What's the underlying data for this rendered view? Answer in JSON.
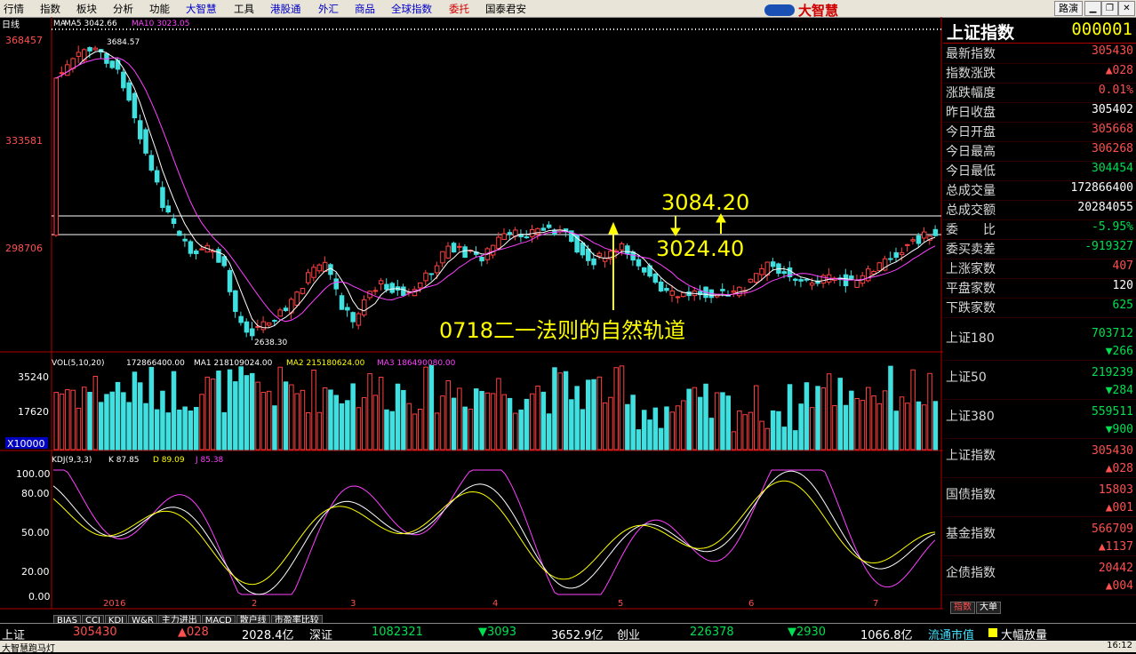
{
  "menu": [
    "行情",
    "指数",
    "板块",
    "分析",
    "功能",
    "大智慧",
    "工具",
    "港股通",
    "外汇",
    "商品",
    "全球指数",
    "委托",
    "国泰君安"
  ],
  "brand": "大智慧",
  "route_label": "路演",
  "chart": {
    "period_label": "日线",
    "ma_header": {
      "ma": "MA",
      "ma5": "MA5 3042.66",
      "ma10": "MA10 3023.05"
    },
    "price_ticks": [
      "368457",
      "333581",
      "298706"
    ],
    "high_label": "3684.57",
    "low_label": "2638.30",
    "annotation_upper": "3084.20",
    "annotation_lower": "3024.40",
    "annotation_text": "0718二一法则的自然轨道",
    "vol_header": {
      "vol": "VOL(5,10,20)",
      "vol_val": "172866400.00",
      "ma1": "MA1 218109024.00",
      "ma2": "MA2 215180624.00",
      "ma3": "MA3 186490080.00"
    },
    "vol_ticks": [
      "35240",
      "17620",
      "X10000"
    ],
    "kdj_header": {
      "name": "KDJ(9,3,3)",
      "k": "K 87.85",
      "d": "D 89.09",
      "j": "J 85.38"
    },
    "kdj_ticks": [
      "100.00",
      "80.00",
      "50.00",
      "20.00",
      "0.00"
    ],
    "x_labels": [
      "2016",
      "2",
      "3",
      "4",
      "5",
      "6",
      "7"
    ],
    "tabs": [
      "BIAS",
      "CCI",
      "KDJ",
      "W&R",
      "主力进出",
      "MACD",
      "散户线",
      "市盈率比较"
    ]
  },
  "chart_data": {
    "type": "candlestick",
    "y_price_ticks": [
      3684.57,
      3335.81,
      2987.06
    ],
    "high": 3684.57,
    "low": 2638.3,
    "levels": [
      3084.2,
      3024.4
    ],
    "volume_ticks_x10000": [
      35240,
      17620
    ],
    "kdj": {
      "K": 87.85,
      "D": 89.09,
      "J": 85.38
    },
    "kdj_range": [
      0,
      100
    ]
  },
  "panel": {
    "title": "上证指数",
    "code": "000001",
    "rows": [
      {
        "label": "最新指数",
        "value": "305430",
        "color": "red"
      },
      {
        "label": "指数涨跌",
        "value": "▲028",
        "color": "red"
      },
      {
        "label": "涨跌幅度",
        "value": "0.01%",
        "color": "red"
      },
      {
        "label": "昨日收盘",
        "value": "305402",
        "color": "wht"
      },
      {
        "label": "今日开盘",
        "value": "305668",
        "color": "red"
      },
      {
        "label": "今日最高",
        "value": "306268",
        "color": "red"
      },
      {
        "label": "今日最低",
        "value": "304454",
        "color": "grn"
      },
      {
        "label": "总成交量",
        "value": "172866400",
        "color": "wht"
      },
      {
        "label": "总成交额",
        "value": "20284055",
        "color": "wht"
      },
      {
        "label": "委　　比",
        "value": "-5.95%",
        "color": "grn"
      },
      {
        "label": "委买卖差",
        "value": "-919327",
        "color": "grn"
      },
      {
        "label": "上涨家数",
        "value": "407",
        "color": "red"
      },
      {
        "label": "平盘家数",
        "value": "120",
        "color": "wht"
      },
      {
        "label": "下跌家数",
        "value": "625",
        "color": "grn"
      }
    ],
    "indices": [
      {
        "label": "上证180",
        "value": "703712",
        "change": "▼266",
        "change_color": "grn",
        "value_color": "grn"
      },
      {
        "label": "上证50",
        "value": "219239",
        "change": "▼284",
        "change_color": "grn",
        "value_color": "grn"
      },
      {
        "label": "上证380",
        "value": "559511",
        "change": "▼900",
        "change_color": "grn",
        "value_color": "grn"
      },
      {
        "label": "上证指数",
        "value": "305430",
        "change": "▲028",
        "change_color": "red",
        "value_color": "red"
      },
      {
        "label": "国债指数",
        "value": "15803",
        "change": "▲001",
        "change_color": "red",
        "value_color": "red"
      },
      {
        "label": "基金指数",
        "value": "566709",
        "change": "▲1137",
        "change_color": "red",
        "value_color": "red"
      },
      {
        "label": "企债指数",
        "value": "20442",
        "change": "▲004",
        "change_color": "red",
        "value_color": "red"
      }
    ],
    "tabs": [
      "指数",
      "大单"
    ]
  },
  "bottom": {
    "items": [
      {
        "text": "上证",
        "color": "wht"
      },
      {
        "text": "305430",
        "color": "red"
      },
      {
        "text": "▲028",
        "color": "red"
      },
      {
        "text": "2028.4亿",
        "color": "wht"
      },
      {
        "text": "深证",
        "color": "wht"
      },
      {
        "text": "1082321",
        "color": "grn"
      },
      {
        "text": "▼3093",
        "color": "grn"
      },
      {
        "text": "3652.9亿",
        "color": "wht"
      },
      {
        "text": "创业",
        "color": "wht"
      },
      {
        "text": "226378",
        "color": "grn"
      },
      {
        "text": "▼2930",
        "color": "grn"
      },
      {
        "text": "1066.8亿",
        "color": "wht"
      },
      {
        "text": "流通市值",
        "color": "cyn"
      },
      {
        "text": "大幅放量",
        "color": "wht"
      }
    ],
    "ticker": "大智慧跑马灯",
    "time": "16:12"
  }
}
